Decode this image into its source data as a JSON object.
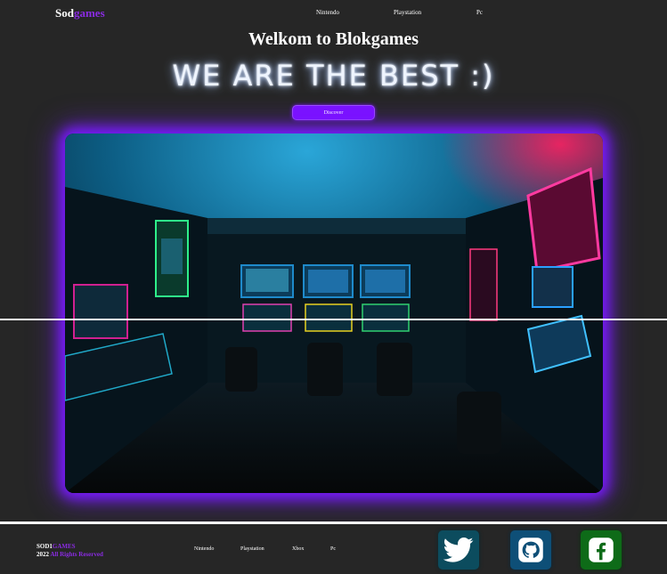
{
  "nav": {
    "logo_main": "Sod",
    "logo_accent": "games",
    "links": [
      "Nintendo",
      "Playstation",
      "Pc"
    ]
  },
  "hero": {
    "title": "Welkom to Blokgames",
    "slogan": "WE ARE THE BEST :)",
    "button": "Discover",
    "image_label": "arcade-room-photo"
  },
  "footer": {
    "brand_main": "SOD1",
    "brand_accent": "GAMES",
    "year": "2022",
    "rights": "All Rights Reserved",
    "links": [
      "Nintendo",
      "Playstation",
      "Xbox",
      "Pc"
    ],
    "social": [
      {
        "icon": "twitter-icon",
        "color": "#0c4c5e"
      },
      {
        "icon": "github-icon",
        "color": "#0e4f77"
      },
      {
        "icon": "facebook-icon",
        "color": "#0e6b18"
      }
    ]
  },
  "colors": {
    "background": "#262626",
    "accent": "#8a2be2",
    "button": "#7b12ff"
  }
}
